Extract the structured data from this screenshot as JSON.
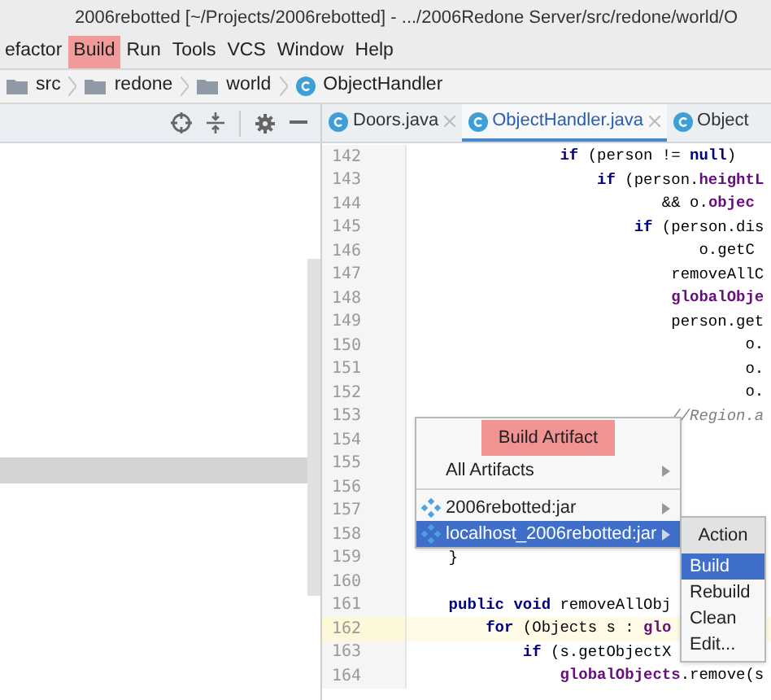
{
  "window": {
    "title": "2006rebotted [~/Projects/2006rebotted] - .../2006Redone Server/src/redone/world/O"
  },
  "menu": [
    {
      "label": "efactor",
      "selected": false
    },
    {
      "label": "Build",
      "selected": true
    },
    {
      "label": "Run",
      "selected": false
    },
    {
      "label": "Tools",
      "selected": false
    },
    {
      "label": "VCS",
      "selected": false
    },
    {
      "label": "Window",
      "selected": false
    },
    {
      "label": "Help",
      "selected": false
    }
  ],
  "breadcrumbs": [
    {
      "label": "src",
      "kind": "folder"
    },
    {
      "label": "redone",
      "kind": "folder"
    },
    {
      "label": "world",
      "kind": "folder"
    },
    {
      "label": "ObjectHandler",
      "kind": "class"
    }
  ],
  "tabs": [
    {
      "label": "Doors.java",
      "selected": false,
      "closable": true
    },
    {
      "label": "ObjectHandler.java",
      "selected": true,
      "closable": true
    },
    {
      "label": "Object",
      "selected": false,
      "closable": false
    }
  ],
  "editor": {
    "lines": [
      {
        "number": "142",
        "current": false,
        "tokens": [
          {
            "t": "                if",
            "kind": "kw"
          },
          {
            "t": " (person != ",
            "kind": "plain"
          },
          {
            "t": "null",
            "kind": "kw"
          },
          {
            "t": ")",
            "kind": "plain"
          }
        ]
      },
      {
        "number": "143",
        "current": false,
        "tokens": [
          {
            "t": "                    if",
            "kind": "kw"
          },
          {
            "t": " (person.",
            "kind": "plain"
          },
          {
            "t": "heightL",
            "kind": "field"
          }
        ]
      },
      {
        "number": "144",
        "current": false,
        "tokens": [
          {
            "t": "                           && o.",
            "kind": "plain"
          },
          {
            "t": "objec",
            "kind": "field"
          }
        ]
      },
      {
        "number": "145",
        "current": false,
        "tokens": [
          {
            "t": "                        if",
            "kind": "kw"
          },
          {
            "t": " (person.dis",
            "kind": "plain"
          }
        ]
      },
      {
        "number": "146",
        "current": false,
        "tokens": [
          {
            "t": "                               o.getC",
            "kind": "plain"
          }
        ]
      },
      {
        "number": "147",
        "current": false,
        "tokens": [
          {
            "t": "                            removeAllC",
            "kind": "plain"
          }
        ]
      },
      {
        "number": "148",
        "current": false,
        "tokens": [
          {
            "t": "                            globalObje",
            "kind": "field"
          }
        ]
      },
      {
        "number": "149",
        "current": false,
        "tokens": [
          {
            "t": "                            person.get",
            "kind": "plain"
          }
        ]
      },
      {
        "number": "150",
        "current": false,
        "tokens": [
          {
            "t": "                                    o.",
            "kind": "plain"
          }
        ]
      },
      {
        "number": "151",
        "current": false,
        "tokens": [
          {
            "t": "                                    o.",
            "kind": "plain"
          }
        ]
      },
      {
        "number": "152",
        "current": false,
        "tokens": [
          {
            "t": "                                    o.",
            "kind": "plain"
          }
        ]
      },
      {
        "number": "153",
        "current": false,
        "tokens": [
          {
            "t": "                            //Region.a",
            "kind": "comment"
          }
        ]
      },
      {
        "number": "154",
        "current": false
      },
      {
        "number": "155",
        "current": false
      },
      {
        "number": "156",
        "current": false
      },
      {
        "number": "157",
        "current": false
      },
      {
        "number": "158",
        "current": false
      },
      {
        "number": "159",
        "current": false,
        "tokens": [
          {
            "t": "    }",
            "kind": "plain"
          }
        ]
      },
      {
        "number": "160",
        "current": false
      },
      {
        "number": "161",
        "current": false,
        "tokens": [
          {
            "t": "    public void",
            "kind": "kw"
          },
          {
            "t": " removeAllObj",
            "kind": "plain"
          }
        ]
      },
      {
        "number": "162",
        "current": true,
        "tokens": [
          {
            "t": "        for",
            "kind": "kw"
          },
          {
            "t": " (Objects s : ",
            "kind": "plain"
          },
          {
            "t": "glo",
            "kind": "field"
          }
        ]
      },
      {
        "number": "163",
        "current": false,
        "tokens": [
          {
            "t": "            if",
            "kind": "kw"
          },
          {
            "t": " (s.getObjectX",
            "kind": "plain"
          }
        ]
      },
      {
        "number": "164",
        "current": false,
        "tokens": [
          {
            "t": "                globalObjects",
            "kind": "field"
          },
          {
            "t": ".remove(s",
            "kind": "plain"
          }
        ]
      }
    ]
  },
  "popup": {
    "title": "Build Artifact",
    "items": [
      {
        "label": "All Artifacts",
        "icon": false,
        "selected": false
      },
      {
        "label": "2006rebotted:jar",
        "icon": true,
        "selected": false
      },
      {
        "label": "localhost_2006rebotted:jar",
        "icon": true,
        "selected": true
      }
    ]
  },
  "submenu": {
    "title": "Action",
    "items": [
      {
        "label": "Build",
        "selected": true
      },
      {
        "label": "Rebuild",
        "selected": false
      },
      {
        "label": "Clean",
        "selected": false
      },
      {
        "label": "Edit...",
        "selected": false
      }
    ]
  }
}
